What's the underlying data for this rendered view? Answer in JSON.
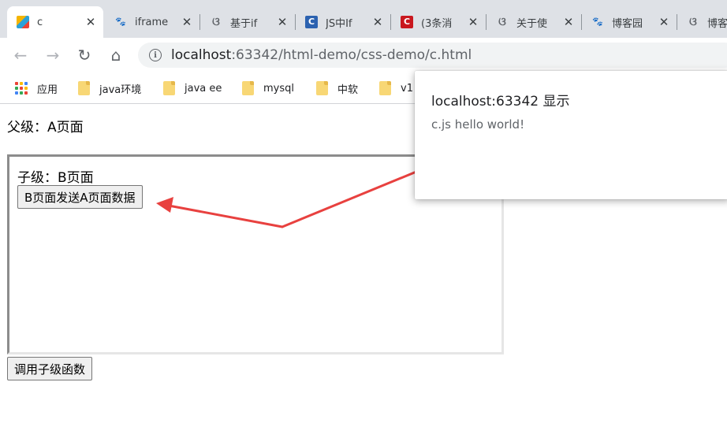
{
  "tabs": [
    {
      "title": "c",
      "icon": "puzzle-icon"
    },
    {
      "title": "iframe",
      "icon": "baidu-paw-icon"
    },
    {
      "title": "基于if",
      "icon": "swirl-icon"
    },
    {
      "title": "JS中If",
      "icon": "square-c-icon"
    },
    {
      "title": "(3条消",
      "icon": "csdn-c-icon"
    },
    {
      "title": "关于使",
      "icon": "swirl-icon"
    },
    {
      "title": "博客园",
      "icon": "baidu-paw-icon"
    },
    {
      "title": "博客",
      "icon": "swirl-icon"
    }
  ],
  "address_bar": {
    "host": "localhost",
    "rest": ":63342/html-demo/css-demo/c.html"
  },
  "bookmarks": {
    "apps_label": "应用",
    "folders": [
      "java环境",
      "java ee",
      "mysql",
      "中软",
      "v1"
    ]
  },
  "page": {
    "parent_label": "父级：A页面",
    "child_label": "子级：B页面",
    "child_button": "B页面发送A页面数据",
    "call_button": "调用子级函数"
  },
  "alert": {
    "title": "localhost:63342 显示",
    "message": "c.js hello world!"
  },
  "colors": {
    "arrow": "#e8413f",
    "tabstrip": "#dee1e6",
    "omnibox": "#f1f3f4"
  }
}
